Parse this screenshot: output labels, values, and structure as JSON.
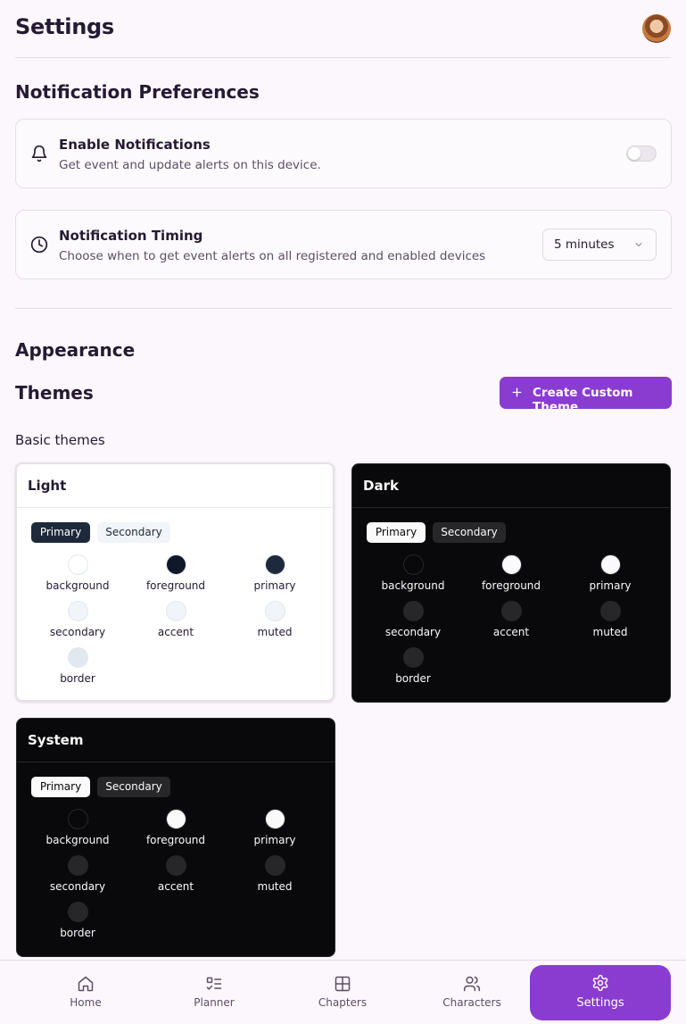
{
  "header": {
    "title": "Settings",
    "avatar_icon": "user-avatar"
  },
  "notifications": {
    "section_title": "Notification Preferences",
    "enable": {
      "title": "Enable Notifications",
      "description": "Get event and update alerts on this device.",
      "enabled": false,
      "icon": "bell-icon"
    },
    "timing": {
      "title": "Notification Timing",
      "description": "Choose when to get event alerts on all registered and enabled devices",
      "selected": "5 minutes",
      "icon": "clock-icon"
    }
  },
  "appearance": {
    "section_title": "Appearance",
    "themes_title": "Themes",
    "create_button": "Create Custom Theme",
    "basic_label": "Basic themes",
    "accent_color": "#8a3bd0",
    "themes": [
      {
        "name": "Light",
        "selected": true,
        "tabs": [
          "Primary",
          "Secondary"
        ],
        "swatches": [
          {
            "name": "background",
            "color": "#ffffff"
          },
          {
            "name": "foreground",
            "color": "#0f172a"
          },
          {
            "name": "primary",
            "color": "#1e293b"
          },
          {
            "name": "secondary",
            "color": "#f1f5f9"
          },
          {
            "name": "accent",
            "color": "#f1f5f9"
          },
          {
            "name": "muted",
            "color": "#f1f5f9"
          },
          {
            "name": "border",
            "color": "#e2e8f0"
          }
        ]
      },
      {
        "name": "Dark",
        "selected": false,
        "tabs": [
          "Primary",
          "Secondary"
        ],
        "swatches": [
          {
            "name": "background",
            "color": "#09090b"
          },
          {
            "name": "foreground",
            "color": "#fafafa"
          },
          {
            "name": "primary",
            "color": "#fafafa"
          },
          {
            "name": "secondary",
            "color": "#27272a"
          },
          {
            "name": "accent",
            "color": "#27272a"
          },
          {
            "name": "muted",
            "color": "#27272a"
          },
          {
            "name": "border",
            "color": "#27272a"
          }
        ]
      },
      {
        "name": "System",
        "selected": false,
        "tabs": [
          "Primary",
          "Secondary"
        ],
        "swatches": [
          {
            "name": "background",
            "color": "#09090b"
          },
          {
            "name": "foreground",
            "color": "#fafafa"
          },
          {
            "name": "primary",
            "color": "#fafafa"
          },
          {
            "name": "secondary",
            "color": "#27272a"
          },
          {
            "name": "accent",
            "color": "#27272a"
          },
          {
            "name": "muted",
            "color": "#27272a"
          },
          {
            "name": "border",
            "color": "#27272a"
          }
        ]
      }
    ]
  },
  "bottom_nav": {
    "items": [
      {
        "label": "Home",
        "icon": "home-icon",
        "active": false
      },
      {
        "label": "Planner",
        "icon": "checklist-icon",
        "active": false
      },
      {
        "label": "Chapters",
        "icon": "grid-icon",
        "active": false
      },
      {
        "label": "Characters",
        "icon": "users-icon",
        "active": false
      },
      {
        "label": "Settings",
        "icon": "gear-icon",
        "active": true
      }
    ]
  }
}
